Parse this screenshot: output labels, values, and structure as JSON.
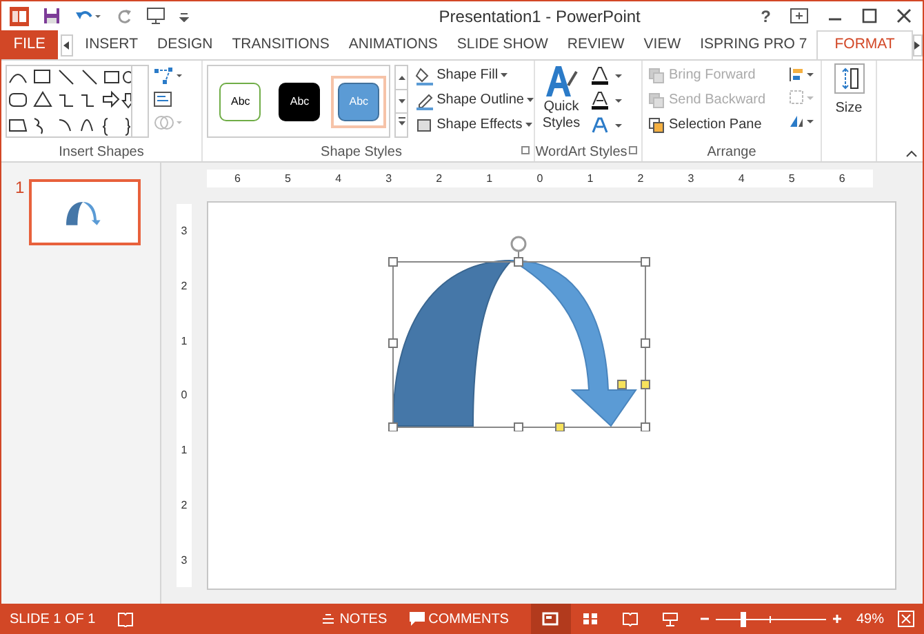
{
  "window": {
    "title": "Presentation1 - PowerPoint",
    "help": "?"
  },
  "file_tab": "FILE",
  "tabs": [
    {
      "label": "INSERT",
      "selected": false
    },
    {
      "label": "DESIGN",
      "selected": false
    },
    {
      "label": "TRANSITIONS",
      "selected": false
    },
    {
      "label": "ANIMATIONS",
      "selected": false
    },
    {
      "label": "SLIDE SHOW",
      "selected": false
    },
    {
      "label": "REVIEW",
      "selected": false
    },
    {
      "label": "VIEW",
      "selected": false
    },
    {
      "label": "ISPRING PRO 7",
      "selected": false
    },
    {
      "label": "FORMAT",
      "selected": true
    }
  ],
  "ribbon": {
    "insert_shapes": {
      "label": "Insert Shapes"
    },
    "shape_styles": {
      "label": "Shape Styles",
      "styles": [
        {
          "label": "Abc",
          "kind": "outline",
          "selected": false
        },
        {
          "label": "Abc",
          "kind": "black",
          "selected": false
        },
        {
          "label": "Abc",
          "kind": "blue",
          "selected": true
        }
      ],
      "commands": [
        "Shape Fill",
        "Shape Outline",
        "Shape Effects"
      ]
    },
    "wordart_styles": {
      "label": "WordArt Styles",
      "quick_styles": "Quick Styles"
    },
    "arrange": {
      "label": "Arrange",
      "items": [
        {
          "label": "Bring Forward",
          "disabled": true
        },
        {
          "label": "Send Backward",
          "disabled": true
        },
        {
          "label": "Selection Pane",
          "disabled": false
        }
      ]
    },
    "size": {
      "label": "Size"
    }
  },
  "slides": [
    {
      "number": "1",
      "selected": true
    }
  ],
  "rulers": {
    "horizontal": [
      "6",
      "5",
      "4",
      "3",
      "2",
      "1",
      "0",
      "1",
      "2",
      "3",
      "4",
      "5",
      "6"
    ],
    "vertical": [
      "3",
      "2",
      "1",
      "0",
      "1",
      "2",
      "3"
    ]
  },
  "status_bar": {
    "slide_info": "SLIDE 1 OF 1",
    "notes": "NOTES",
    "comments": "COMMENTS",
    "views": [
      {
        "selected": true
      },
      {
        "selected": false
      },
      {
        "selected": false
      },
      {
        "selected": false
      }
    ],
    "zoom": {
      "level": 0.25
    },
    "zoom_text": "49%"
  }
}
